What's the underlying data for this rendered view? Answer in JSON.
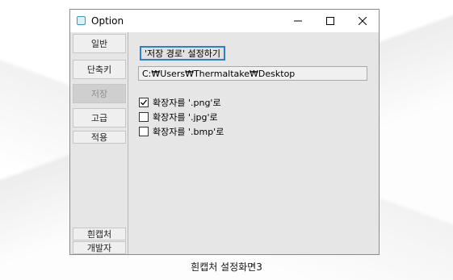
{
  "window": {
    "title": "Option"
  },
  "sidebar": {
    "items": [
      {
        "label": "일반"
      },
      {
        "label": "단축키"
      },
      {
        "label": "저장"
      },
      {
        "label": "고급"
      },
      {
        "label": "적용"
      },
      {
        "label": "흰캡처"
      },
      {
        "label": "개발자"
      }
    ],
    "active_index": 2
  },
  "save": {
    "path_button_label": "'저장 경로' 설정하기",
    "path_value": "C:₩Users₩Thermaltake₩Desktop",
    "options": [
      {
        "label": "확장자를 '.png'로",
        "checked": true
      },
      {
        "label": "확장자를 '.jpg'로",
        "checked": false
      },
      {
        "label": "확장자를 '.bmp'로",
        "checked": false
      }
    ]
  },
  "caption": "흰캡처 설정화면3"
}
